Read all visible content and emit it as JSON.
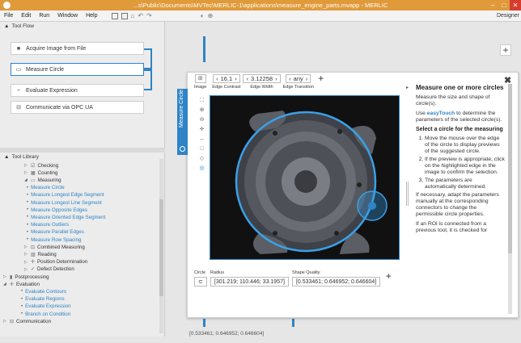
{
  "window": {
    "title": "...s\\Public\\Documents\\MVTec\\MERLIC-1\\applications\\measure_engine_parts.mvapp - MERLIC",
    "minimize": "–",
    "maximize": "□",
    "close": "✕"
  },
  "menu": {
    "items": [
      "File",
      "Edit",
      "Run",
      "Window",
      "Help"
    ],
    "toolbar_glyphs": [
      "⌂",
      "↶",
      "↷"
    ],
    "nav_glyphs": [
      "◐",
      "⊕"
    ],
    "mode": "Designer"
  },
  "toolflow": {
    "header": "Tool Flow",
    "items": [
      {
        "label": "Acquire Image from File",
        "icon": "camera-icon",
        "glyph": "■"
      },
      {
        "label": "Measure Circle",
        "icon": "measure-icon",
        "glyph": "▭"
      },
      {
        "label": "Evaluate Expression",
        "icon": "expression-icon",
        "glyph": "÷"
      },
      {
        "label": "Communicate via OPC UA",
        "icon": "opc-icon",
        "glyph": "⊟"
      }
    ]
  },
  "toollib": {
    "header": "Tool Library",
    "rows": [
      {
        "label": "Checking",
        "level": 1,
        "tri": "▷",
        "glyph": "☑",
        "leaf": false
      },
      {
        "label": "Counting",
        "level": 1,
        "tri": "▷",
        "glyph": "▦",
        "leaf": false
      },
      {
        "label": "Measuring",
        "level": 1,
        "tri": "◢",
        "glyph": "▭",
        "leaf": false
      },
      {
        "label": "Measure Circle",
        "level": 2,
        "tri": "",
        "glyph": "•",
        "leaf": true
      },
      {
        "label": "Measure Longest Edge Segment",
        "level": 2,
        "tri": "",
        "glyph": "•",
        "leaf": true
      },
      {
        "label": "Measure Longest Line Segment",
        "level": 2,
        "tri": "",
        "glyph": "•",
        "leaf": true
      },
      {
        "label": "Measure Opposite Edges",
        "level": 2,
        "tri": "",
        "glyph": "•",
        "leaf": true
      },
      {
        "label": "Measure Oriented Edge Segment",
        "level": 2,
        "tri": "",
        "glyph": "•",
        "leaf": true
      },
      {
        "label": "Measure Outliers",
        "level": 2,
        "tri": "",
        "glyph": "•",
        "leaf": true
      },
      {
        "label": "Measure Parallel Edges",
        "level": 2,
        "tri": "",
        "glyph": "•",
        "leaf": true
      },
      {
        "label": "Measure Row Spacing",
        "level": 2,
        "tri": "",
        "glyph": "•",
        "leaf": true
      },
      {
        "label": "Combined Measuring",
        "level": 1,
        "tri": "▷",
        "glyph": "⊡",
        "leaf": false
      },
      {
        "label": "Reading",
        "level": 1,
        "tri": "▷",
        "glyph": "▥",
        "leaf": false
      },
      {
        "label": "Position Determination",
        "level": 1,
        "tri": "▷",
        "glyph": "✛",
        "leaf": false
      },
      {
        "label": "Defect Detection",
        "level": 1,
        "tri": "▷",
        "glyph": "✓",
        "leaf": false
      },
      {
        "label": "Postprocessing",
        "level": 0,
        "tri": "▷",
        "glyph": "▮",
        "leaf": false
      },
      {
        "label": "Evaluation",
        "level": 0,
        "tri": "◢",
        "glyph": "✛",
        "leaf": false
      },
      {
        "label": "Evaluate Contours",
        "level": 1,
        "tri": "",
        "glyph": "•",
        "leaf": true
      },
      {
        "label": "Evaluate Regions",
        "level": 1,
        "tri": "",
        "glyph": "•",
        "leaf": true
      },
      {
        "label": "Evaluate Expression",
        "level": 1,
        "tri": "",
        "glyph": "•",
        "leaf": true
      },
      {
        "label": "Branch on Condition",
        "level": 1,
        "tri": "",
        "glyph": "•",
        "leaf": true
      },
      {
        "label": "Communication",
        "level": 0,
        "tri": "▷",
        "glyph": "⊟",
        "leaf": false
      }
    ]
  },
  "board": {
    "tab_label": "Measure Circle",
    "params": {
      "image_label": "Image",
      "edge_contrast": {
        "value": "16.1",
        "label": "Edge Contrast"
      },
      "edge_width": {
        "value": "3.12258",
        "label": "Edge Width"
      },
      "edge_transition": {
        "value": "any",
        "label": "Edge Transition"
      },
      "add": "+"
    },
    "side_tools": [
      "⛶",
      "⊕",
      "⊖",
      "✛",
      "↔",
      "□",
      "◇",
      "◎"
    ],
    "outputs": {
      "circle_label": "Circle",
      "circle_glyph": "⊂",
      "radius_label": "Radius",
      "radius_value": "[301.219; 110.446; 33.1957]",
      "shape_label": "Shape Quality",
      "shape_value": "[0.533461; 0.646952; 0.646604]",
      "add": "+"
    },
    "help": {
      "title": "Measure one or more circles",
      "intro": "Measure the size and shape of circle(s).",
      "use_prefix": "Use",
      "easy_touch": "easyTouch",
      "use_suffix": "to determine the parameters of the selected circle(s).",
      "select_heading": "Select a circle for the measuring",
      "steps": [
        "Move the mouse over the edge of the circle to display previews of the suggested circle.",
        "If the preview is appropriate, click on the highlighted edge in the image to confirm the selection.",
        "The parameters are automatically determined."
      ],
      "p2": "If necessary, adapt the parameters manually at the corresponding connectors to change the permissible circle properties.",
      "p3": "If an ROI is connected from a previous tool, it is checked for"
    },
    "close": "✖",
    "split_arrow": "▸"
  },
  "canvas": {
    "plus": "+",
    "bottom_text": "[0.533461; 0.646952; 0.646604]"
  }
}
